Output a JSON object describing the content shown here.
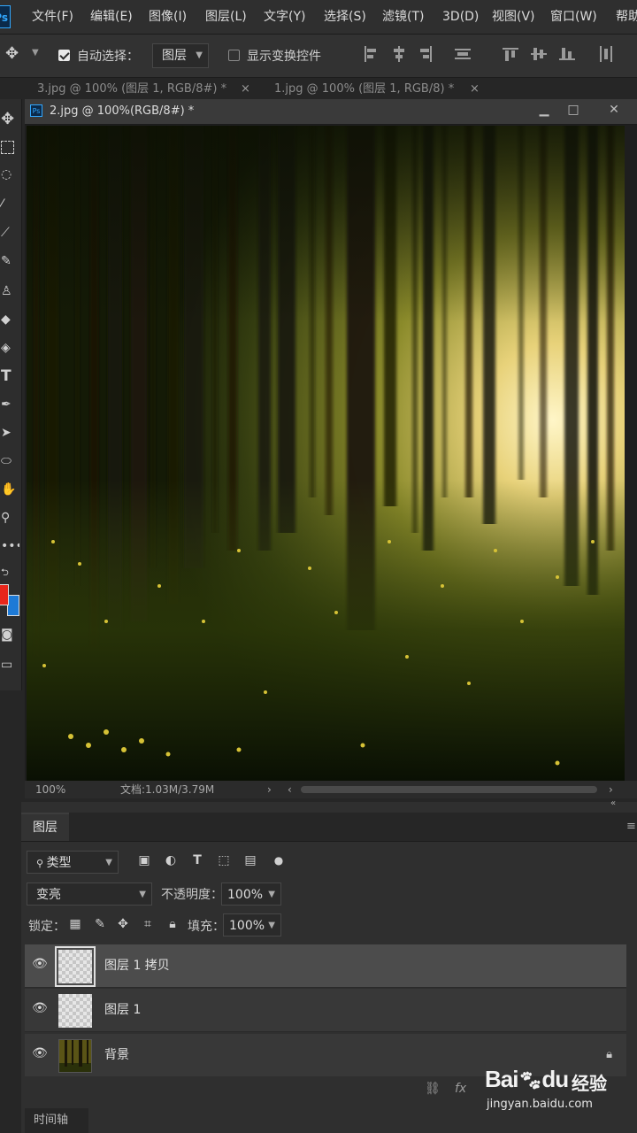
{
  "app": {
    "logo": "Ps"
  },
  "menu": [
    "文件(F)",
    "编辑(E)",
    "图像(I)",
    "图层(L)",
    "文字(Y)",
    "选择(S)",
    "滤镜(T)",
    "3D(D)",
    "视图(V)",
    "窗口(W)",
    "帮助"
  ],
  "options_bar": {
    "auto_select_label": "自动选择：",
    "auto_select_checked": true,
    "auto_select_target": "图层",
    "show_transform_label": "显示变换控件",
    "show_transform_checked": false
  },
  "tabs": [
    {
      "label": "3.jpg @ 100% (图层 1, RGB/8#) *",
      "close": "×"
    },
    {
      "label": "1.jpg @ 100% (图层 1, RGB/8) *",
      "close": "×"
    }
  ],
  "document": {
    "title": "2.jpg @ 100%(RGB/8#) *",
    "minimize": "▁",
    "maximize": "□",
    "close": "✕"
  },
  "status": {
    "zoom": "100%",
    "doc_size": "文档:1.03M/3.79M"
  },
  "toolbar_icons": [
    "move-icon",
    "marquee-icon",
    "lasso-icon",
    "magic-wand-icon",
    "eyedropper-icon",
    "brush-icon",
    "stamp-icon",
    "eraser-icon",
    "paint-bucket-icon",
    "type-icon",
    "pen-icon",
    "path-select-icon",
    "ellipse-icon",
    "hand-icon",
    "zoom-icon",
    "more-icon"
  ],
  "colors": {
    "foreground": "#e8261b",
    "background": "#1e7ad6",
    "accent": "#31a8ff"
  },
  "layers_panel": {
    "tab": "图层",
    "filter_kind": "类型",
    "blend_mode": "变亮",
    "opacity_label": "不透明度：",
    "opacity_value": "100%",
    "lock_label": "锁定：",
    "fill_label": "填充：",
    "fill_value": "100%",
    "layers": [
      {
        "name": "图层 1 拷贝",
        "selected": true,
        "locked": false
      },
      {
        "name": "图层 1",
        "selected": false,
        "locked": false
      },
      {
        "name": "背景",
        "selected": false,
        "locked": true
      }
    ],
    "footer": {
      "link": "⛓",
      "fx": "fx"
    }
  },
  "watermark": {
    "brand": "Bai",
    "brand2": "du",
    "label": "经验",
    "url": "jingyan.baidu.com"
  },
  "bottom_tab": "时间轴"
}
